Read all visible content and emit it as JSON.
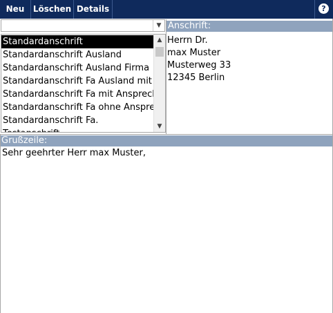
{
  "toolbar": {
    "buttons": [
      "Neu",
      "Löschen",
      "Details"
    ],
    "help_icon": "question-circle-icon"
  },
  "template_combo": {
    "value": ""
  },
  "template_list": {
    "items": [
      "Standardanschrift",
      "Standardanschrift Ausland",
      "Standardanschrift Ausland Firma",
      "Standardanschrift Fa Ausland mit A",
      "Standardanschrift Fa mit Ansprechp",
      "Standardanschrift Fa ohne Ansprech",
      "Standardanschrift Fa.",
      "Testanschrift"
    ],
    "selected_index": 0
  },
  "address": {
    "header": "Anschrift:",
    "lines": [
      "Herrn Dr.",
      "max Muster",
      "Musterweg 33",
      "12345 Berlin"
    ]
  },
  "greeting": {
    "header": "Grußzeile:",
    "text": "Sehr geehrter Herr max Muster,"
  },
  "colors": {
    "toolbar_bg": "#0f2a5c",
    "section_header_bg": "#8fa3bd",
    "selection_bg": "#000000"
  }
}
